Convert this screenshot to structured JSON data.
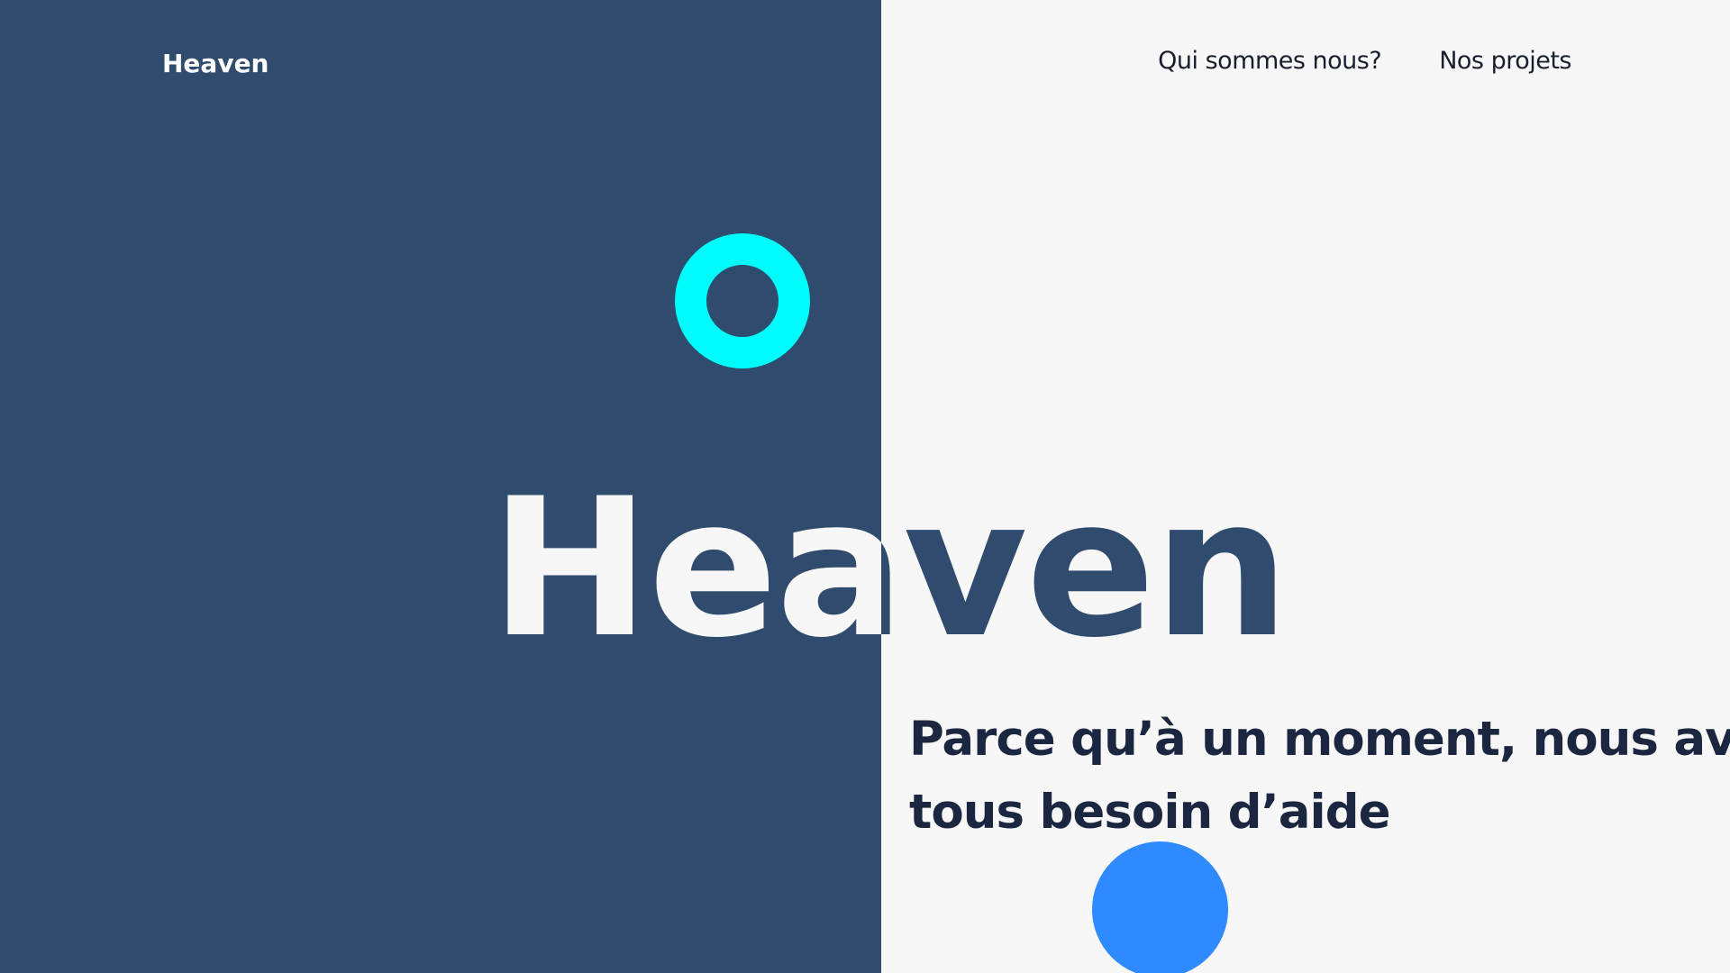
{
  "header": {
    "brand": "Heaven",
    "nav": [
      {
        "label": "Qui sommes nous?"
      },
      {
        "label": "Nos projets"
      }
    ]
  },
  "hero": {
    "title": "Heaven",
    "subtitle": "Parce qu’à un moment, nous avons tous besoin d’aide"
  },
  "colors": {
    "panel": "#2f4c6e",
    "background": "#f7f7f7",
    "ring": "#00fbfb",
    "dot": "#2f8aff",
    "subtitle": "#1b2640"
  }
}
